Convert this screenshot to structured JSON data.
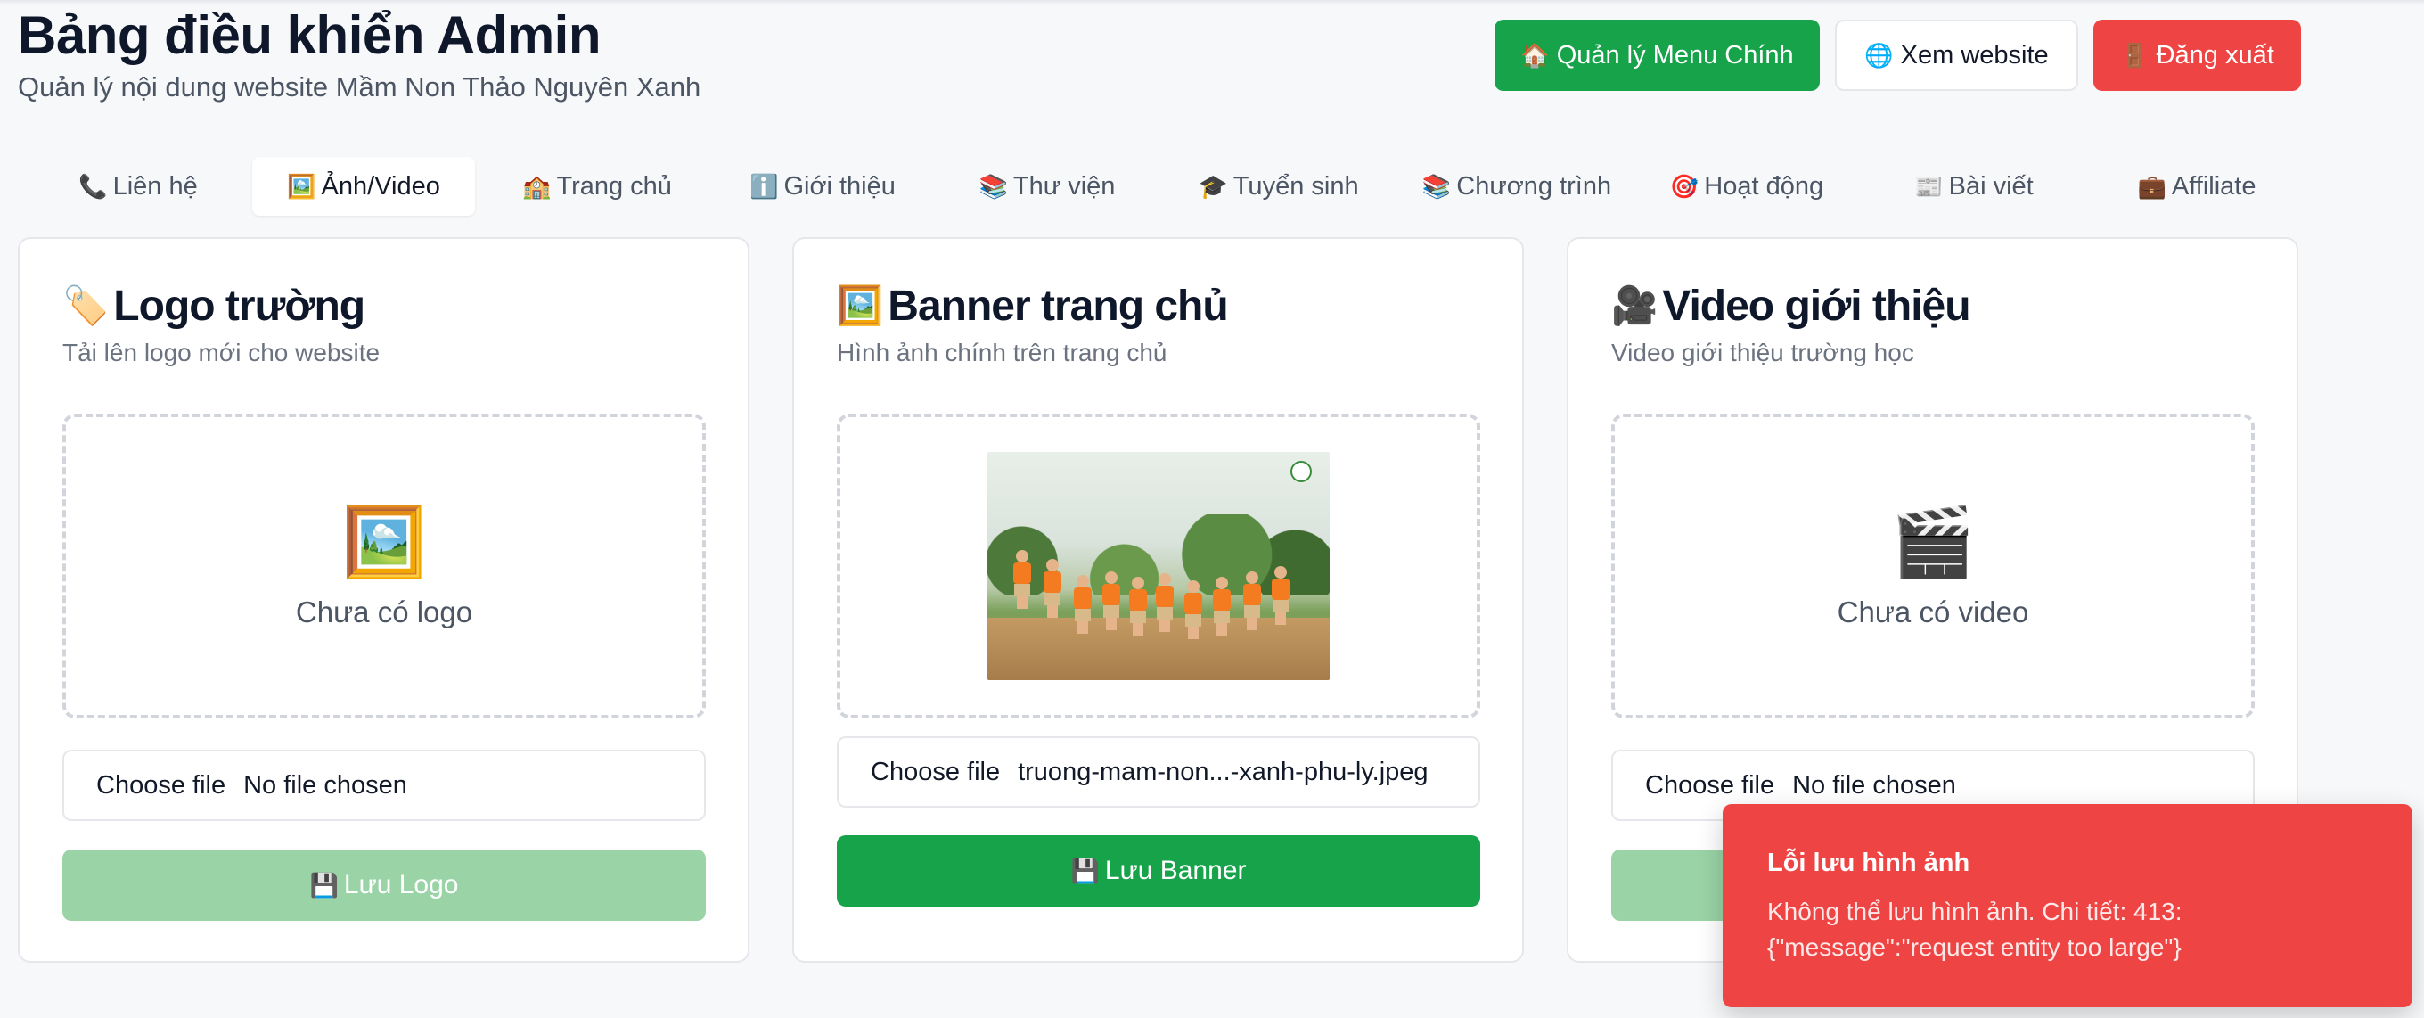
{
  "header": {
    "title": "Bảng điều khiển Admin",
    "subtitle": "Quản lý nội dung website Mầm Non Thảo Nguyên Xanh",
    "actions": [
      {
        "icon": "🏠",
        "label": "Quản lý Menu Chính"
      },
      {
        "icon": "🌐",
        "label": "Xem website"
      },
      {
        "icon": "🚪",
        "label": "Đăng xuất"
      }
    ]
  },
  "tabs": [
    {
      "icon": "📞",
      "label": "Liên hệ"
    },
    {
      "icon": "🖼️",
      "label": "Ảnh/Video",
      "active": true
    },
    {
      "icon": "🏫",
      "label": "Trang chủ"
    },
    {
      "icon": "ℹ️",
      "label": "Giới thiệu"
    },
    {
      "icon": "📚",
      "label": "Thư viện"
    },
    {
      "icon": "🎓",
      "label": "Tuyển sinh"
    },
    {
      "icon": "📚",
      "label": "Chương trình"
    },
    {
      "icon": "🎯",
      "label": "Hoạt động"
    },
    {
      "icon": "📰",
      "label": "Bài viết"
    },
    {
      "icon": "💼",
      "label": "Affiliate"
    }
  ],
  "cards": {
    "logo": {
      "icon": "🏷️",
      "title": "Logo trường",
      "subtitle": "Tải lên logo mới cho website",
      "placeholder_icon": "🖼️",
      "placeholder_text": "Chưa có logo",
      "file_button": "Choose file",
      "file_name": "No file chosen",
      "save_icon": "💾",
      "save_label": "Lưu Logo"
    },
    "banner": {
      "icon": "🖼️",
      "title": "Banner trang chủ",
      "subtitle": "Hình ảnh chính trên trang chủ",
      "file_button": "Choose file",
      "file_name": "truong-mam-non...-xanh-phu-ly.jpeg",
      "save_icon": "💾",
      "save_label": "Lưu Banner"
    },
    "video": {
      "icon": "🎥",
      "title": "Video giới thiệu",
      "subtitle": "Video giới thiệu trường học",
      "placeholder_icon": "🎬",
      "placeholder_text": "Chưa có video",
      "file_button": "Choose file",
      "file_name": "No file chosen"
    }
  },
  "toast": {
    "title": "Lỗi lưu hình ảnh",
    "message": "Không thể lưu hình ảnh. Chi tiết: 413: {\"message\":\"request entity too large\"}"
  },
  "colors": {
    "accent_green": "#16a34a",
    "disabled_green": "#9ad4a6",
    "danger_red": "#ef4444"
  }
}
